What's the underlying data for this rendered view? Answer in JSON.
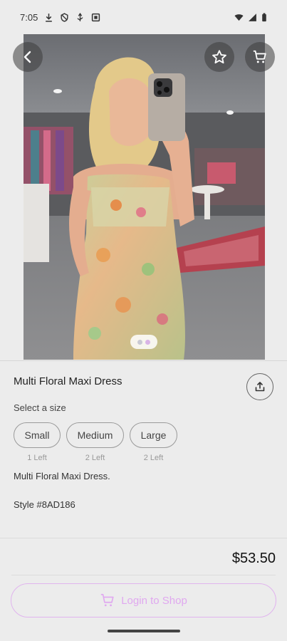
{
  "status_bar": {
    "time": "7:05"
  },
  "product": {
    "title": "Multi Floral Maxi Dress",
    "size_prompt": "Select a size",
    "sizes": [
      {
        "label": "Small",
        "stock": "1 Left"
      },
      {
        "label": "Medium",
        "stock": "2 Left"
      },
      {
        "label": "Large",
        "stock": "2 Left"
      }
    ],
    "description": "Multi Floral Maxi Dress.",
    "style_number": "Style #8AD186",
    "price": "$53.50"
  },
  "gallery": {
    "image_count": 2,
    "active_index": 0
  },
  "actions": {
    "login_label": "Login to Shop"
  },
  "icons": {
    "back": "back-arrow-icon",
    "favorite": "star-icon",
    "cart": "cart-icon",
    "share": "share-icon"
  },
  "colors": {
    "accent": "#e0a8f0",
    "background": "#ececec"
  }
}
